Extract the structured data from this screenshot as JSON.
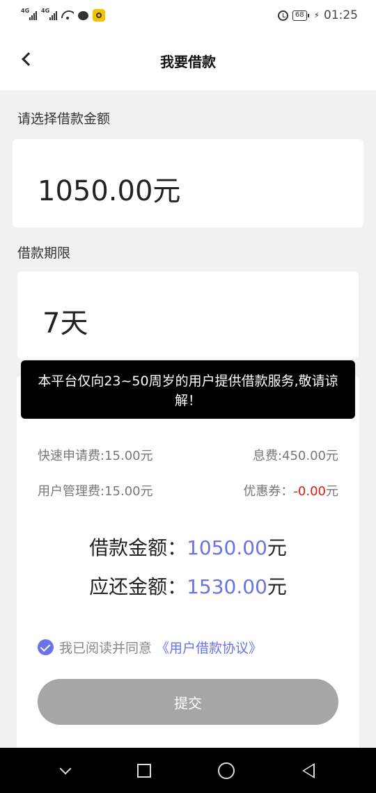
{
  "status_bar": {
    "network_1": "4G",
    "network_2": "4G",
    "battery": "68",
    "time": "01:25"
  },
  "header": {
    "title": "我要借款"
  },
  "amount_section": {
    "label": "请选择借款金额",
    "value": "1050.00元"
  },
  "term_section": {
    "label": "借款期限",
    "value": "7天"
  },
  "toast": {
    "message": "本平台仅向23~50周岁的用户提供借款服务,敬请谅解！"
  },
  "fees": {
    "quick_apply_fee": "快速申请费:15.00元",
    "interest": "息费:450.00元",
    "management_fee": "用户管理费:15.00元",
    "coupon_label": "优惠券：",
    "coupon_value": "-0.00",
    "coupon_unit": "元"
  },
  "totals": {
    "loan_label": "借款金额：",
    "loan_value": "1050.00",
    "loan_unit": "元",
    "repay_label": "应还金额：",
    "repay_value": "1530.00",
    "repay_unit": "元"
  },
  "agreement": {
    "text": "我已阅读并同意",
    "link": "《用户借款协议》"
  },
  "submit": {
    "label": "提交"
  },
  "colors": {
    "accent": "#6a73e6",
    "discount_red": "#e01818",
    "button_disabled": "#a6a6a6"
  }
}
